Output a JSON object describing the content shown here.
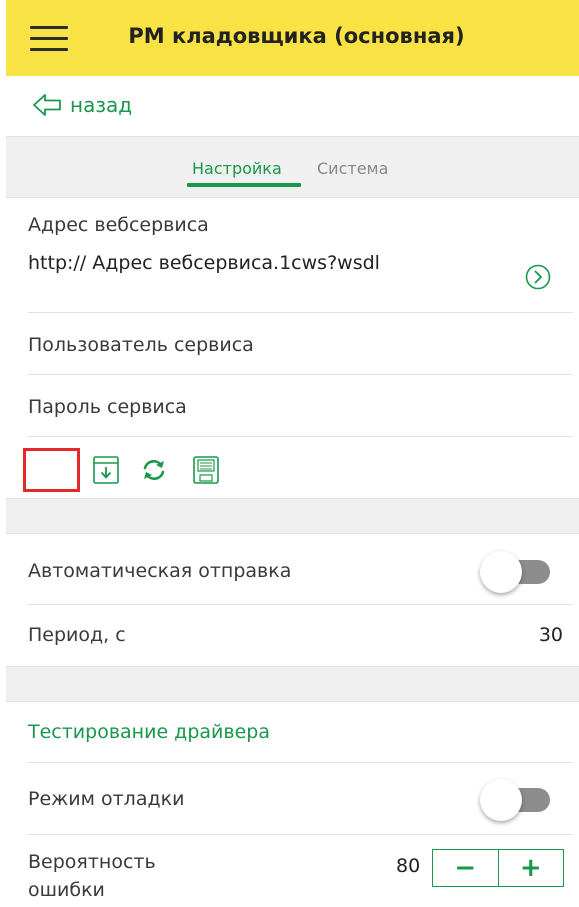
{
  "header": {
    "title": "РМ кладовщика (основная)",
    "menu_icon": "hamburger-icon"
  },
  "nav": {
    "back_label": "назад",
    "back_icon": "back-arrow-icon"
  },
  "tabs": [
    {
      "label": "Настройка",
      "active": true
    },
    {
      "label": "Система",
      "active": false
    }
  ],
  "settings": {
    "webservice_label": "Адрес вебсервиса",
    "webservice_value": "http:// Адрес вебсервиса.1cws?wsdl",
    "user_label": "Пользователь сервиса",
    "password_label": "Пароль сервиса"
  },
  "toolbar": {
    "icons": [
      "download-icon",
      "refresh-icon",
      "save-icon"
    ]
  },
  "auto_send": {
    "label": "Автоматическая отправка",
    "enabled": false,
    "period_label": "Период, с",
    "period_value": "30"
  },
  "driver_test": {
    "title": "Тестирование драйвера",
    "debug_label": "Режим отладки",
    "debug_enabled": false,
    "error_prob_label": "Вероятность ошибки",
    "error_prob_value": "80",
    "minus_label": "−",
    "plus_label": "+"
  },
  "colors": {
    "accent": "#17984a",
    "header_bg": "#f9e243",
    "highlight": "#e32a2a"
  }
}
